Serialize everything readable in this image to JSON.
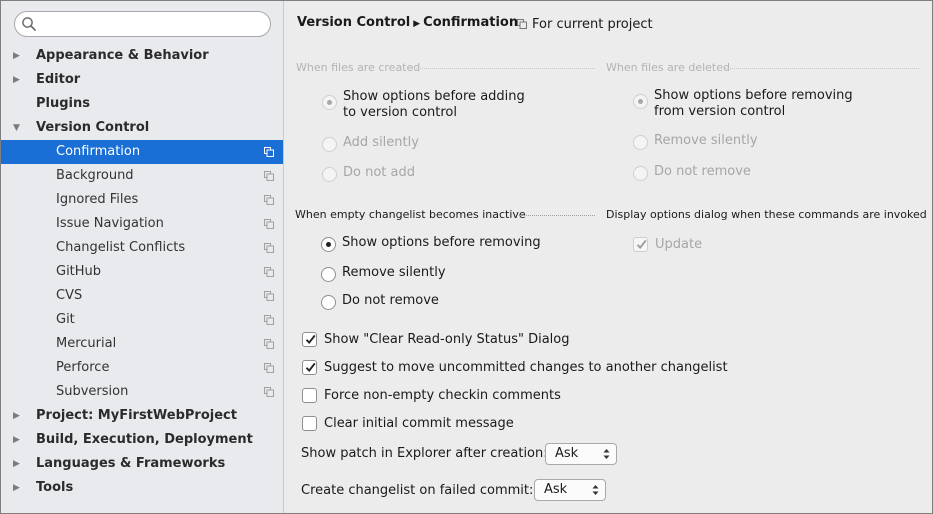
{
  "search": {
    "placeholder": ""
  },
  "sidebar": {
    "items": [
      {
        "label": "Appearance & Behavior",
        "level": 0,
        "arrow": "right"
      },
      {
        "label": "Editor",
        "level": 0,
        "arrow": "right"
      },
      {
        "label": "Plugins",
        "level": 0,
        "arrow": ""
      },
      {
        "label": "Version Control",
        "level": 0,
        "arrow": "down"
      },
      {
        "label": "Confirmation",
        "level": 1,
        "selected": true
      },
      {
        "label": "Background",
        "level": 1
      },
      {
        "label": "Ignored Files",
        "level": 1
      },
      {
        "label": "Issue Navigation",
        "level": 1
      },
      {
        "label": "Changelist Conflicts",
        "level": 1
      },
      {
        "label": "GitHub",
        "level": 1
      },
      {
        "label": "CVS",
        "level": 1
      },
      {
        "label": "Git",
        "level": 1
      },
      {
        "label": "Mercurial",
        "level": 1
      },
      {
        "label": "Perforce",
        "level": 1
      },
      {
        "label": "Subversion",
        "level": 1
      },
      {
        "label": "Project: MyFirstWebProject",
        "level": 0,
        "arrow": "right"
      },
      {
        "label": "Build, Execution, Deployment",
        "level": 0,
        "arrow": "right"
      },
      {
        "label": "Languages & Frameworks",
        "level": 0,
        "arrow": "right"
      },
      {
        "label": "Tools",
        "level": 0,
        "arrow": "right"
      }
    ]
  },
  "header": {
    "breadcrumb_parent": "Version Control",
    "breadcrumb_current": "Confirmation",
    "scope_label": "For current project"
  },
  "files_created": {
    "title": "When files are created",
    "options": [
      {
        "label_line1": "Show options before adding",
        "label_line2": "to version control",
        "selected": true
      },
      {
        "label_line1": "Add silently",
        "selected": false
      },
      {
        "label_line1": "Do not add",
        "selected": false
      }
    ]
  },
  "files_deleted": {
    "title": "When files are deleted",
    "options": [
      {
        "label_line1": "Show options before removing",
        "label_line2": "from version control",
        "selected": true
      },
      {
        "label_line1": "Remove silently",
        "selected": false
      },
      {
        "label_line1": "Do not remove",
        "selected": false
      }
    ]
  },
  "empty_changelist": {
    "title": "When empty changelist becomes inactive",
    "options": [
      {
        "label": "Show options before removing",
        "selected": true
      },
      {
        "label": "Remove silently",
        "selected": false
      },
      {
        "label": "Do not remove",
        "selected": false
      }
    ]
  },
  "display_options": {
    "title": "Display options dialog when these commands are invoked",
    "update_label": "Update",
    "update_checked": true
  },
  "checks": [
    {
      "label": "Show \"Clear Read-only Status\" Dialog",
      "checked": true
    },
    {
      "label": "Suggest to move uncommitted changes to another changelist",
      "checked": true
    },
    {
      "label": "Force non-empty checkin comments",
      "checked": false
    },
    {
      "label": "Clear initial commit message",
      "checked": false
    }
  ],
  "show_patch": {
    "label": "Show patch in Explorer after creation:",
    "value": "Ask"
  },
  "create_changelist": {
    "label": "Create changelist on failed commit:",
    "value": "Ask"
  },
  "colors": {
    "selection": "#1a6fd6",
    "sidebar_bg": "#e8eaed",
    "panel_bg": "#ececec"
  }
}
